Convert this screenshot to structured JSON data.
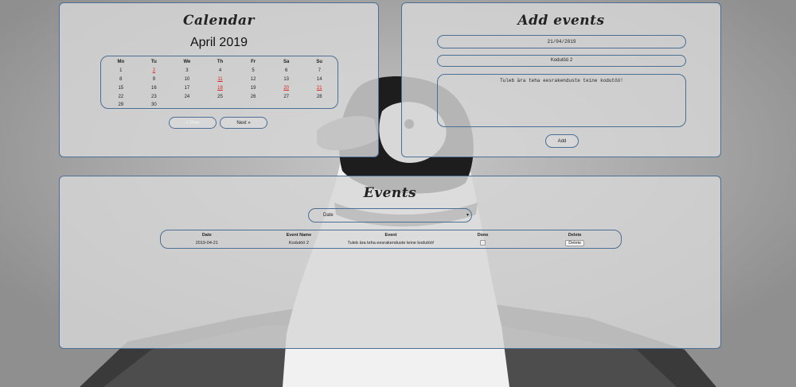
{
  "calendar": {
    "title": "Calendar",
    "month_label": "April 2019",
    "weekdays": [
      "Mo",
      "Tu",
      "We",
      "Th",
      "Fr",
      "Sa",
      "Su"
    ],
    "weeks": [
      [
        "1",
        "2",
        "3",
        "4",
        "5",
        "6",
        "7"
      ],
      [
        "8",
        "9",
        "10",
        "11",
        "12",
        "13",
        "14"
      ],
      [
        "15",
        "16",
        "17",
        "18",
        "19",
        "20",
        "21"
      ],
      [
        "22",
        "23",
        "24",
        "25",
        "26",
        "27",
        "28"
      ],
      [
        "29",
        "30",
        "",
        "",
        "",
        "",
        ""
      ]
    ],
    "highlighted_days": [
      "2",
      "11",
      "18",
      "20",
      "21"
    ],
    "highlight_color": "#dd2222",
    "prev_label": "« Prev",
    "next_label": "Next »"
  },
  "add_events": {
    "title": "Add events",
    "date_value": "21/04/2019",
    "name_value": "Kodutöö 2",
    "description_value": "Tuleb ära teha eesrakenduste teine kodutöö!",
    "add_label": "Add"
  },
  "events": {
    "title": "Events",
    "sort_selected": "Date",
    "columns": [
      "Date",
      "Event Name",
      "Event",
      "Done",
      "Delete"
    ],
    "rows": [
      {
        "date": "2019-04-21",
        "name": "Kodutöö 2",
        "event": "Tuleb ära teha eesrakenduste teine kodutöö!",
        "done": false,
        "delete_label": "Delete"
      }
    ]
  },
  "colors": {
    "accent_border": "#4b6f95",
    "panel_bg": "rgba(215,215,215,0.82)"
  }
}
